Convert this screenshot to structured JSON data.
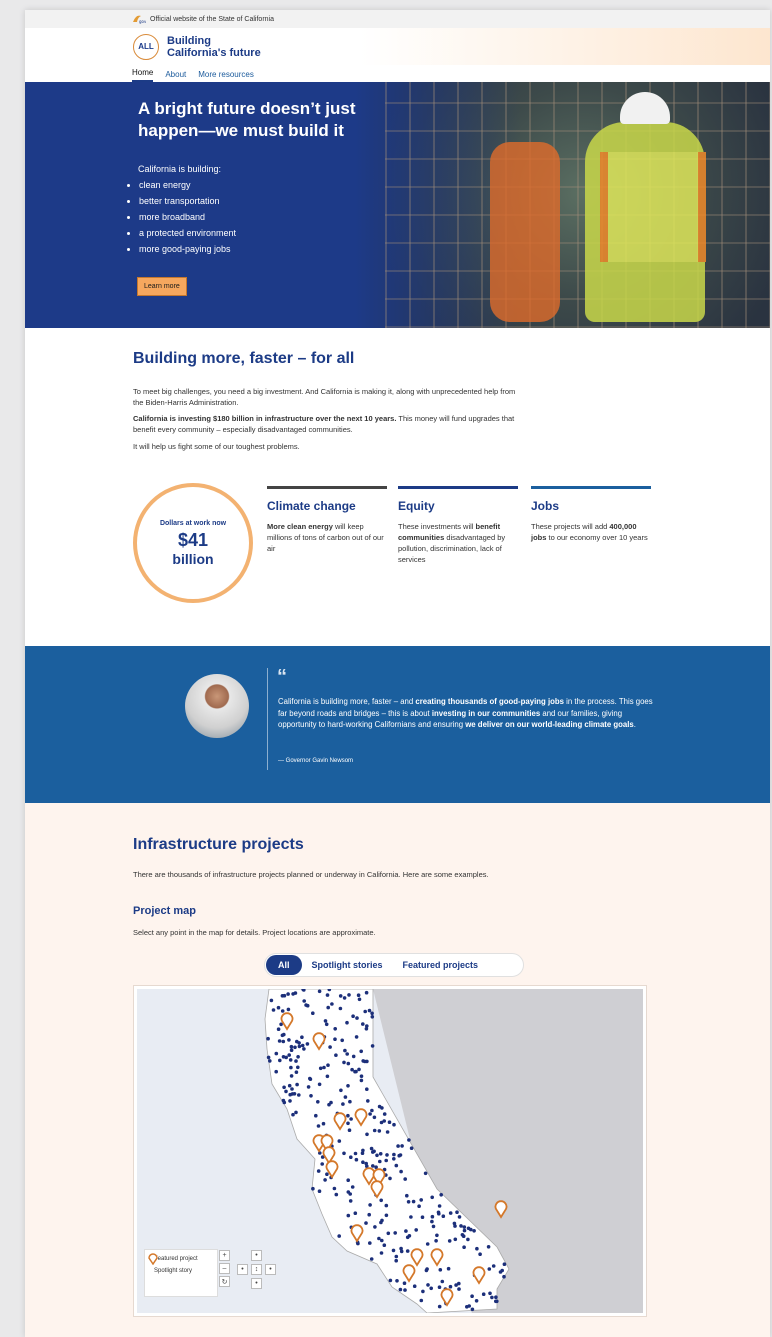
{
  "govbar": {
    "text": "Official website of the State of California"
  },
  "brand": {
    "emblem": "ALL",
    "title_line1": "Building",
    "title_line2": "California's future"
  },
  "nav": [
    "Home",
    "About",
    "More resources"
  ],
  "hero": {
    "title": "A bright future doesn’t just happen—we must build it",
    "sub": "California is building:",
    "items": [
      "clean energy",
      "better transportation",
      "more broadband",
      "a protected environment",
      "more good-paying jobs"
    ],
    "button": "Learn more"
  },
  "section": {
    "title": "Building more, faster – for all",
    "p1": "To meet big challenges, you need a big investment. And California is making it, along with unprecedented help from the Biden-Harris Administration.",
    "p2_bold": "California is investing $180 billion in infrastructure over the next 10 years.",
    "p2_rest": " This money will fund upgrades that benefit every community – especially disadvantaged communities.",
    "p3": "It will help us fight some of our toughest problems.",
    "stat": {
      "label": "Dollars at work now",
      "value": "$41",
      "unit": "billion"
    },
    "cols": [
      {
        "title": "Climate change",
        "bold": "More clean energy",
        "text": " will keep millions of tons of carbon out of our air",
        "color": "#444444"
      },
      {
        "title": "Equity",
        "pre": "These investments will ",
        "bold": "benefit communities",
        "text": " disadvantaged by pollution, discrimination, lack of services",
        "color": "#1c3b86"
      },
      {
        "title": "Jobs",
        "pre": "These projects will add ",
        "bold": "400,000 jobs",
        "text": " to our economy over 10 years",
        "color": "#1b5f9e"
      }
    ]
  },
  "quote": {
    "mark": "66",
    "t1": "California is building more, faster – and ",
    "b1": "creating thousands of good-paying jobs",
    "t2": " in the process. This goes far beyond roads and bridges – this is about ",
    "b2": "investing in our communities",
    "t3": " and our families, giving opportunity to hard-working Californians and ensuring ",
    "b3": "we deliver on our world-leading climate goals",
    "t4": ".",
    "attribution": "— Governor Gavin Newsom"
  },
  "projects": {
    "title": "Infrastructure projects",
    "intro": "There are thousands of infrastructure projects planned or underway in California. Here are some examples.",
    "map_title": "Project map",
    "hint": "Select any point in the map for details. Project locations are approximate.",
    "tabs": [
      "All",
      "Spotlight stories",
      "Featured projects"
    ],
    "legend": [
      "Featured project",
      "Spotlight story"
    ]
  },
  "colors": {
    "navy": "#1c3b86",
    "blue": "#1b5f9e",
    "orange": "#f3b271",
    "cream": "#fef4ee"
  }
}
